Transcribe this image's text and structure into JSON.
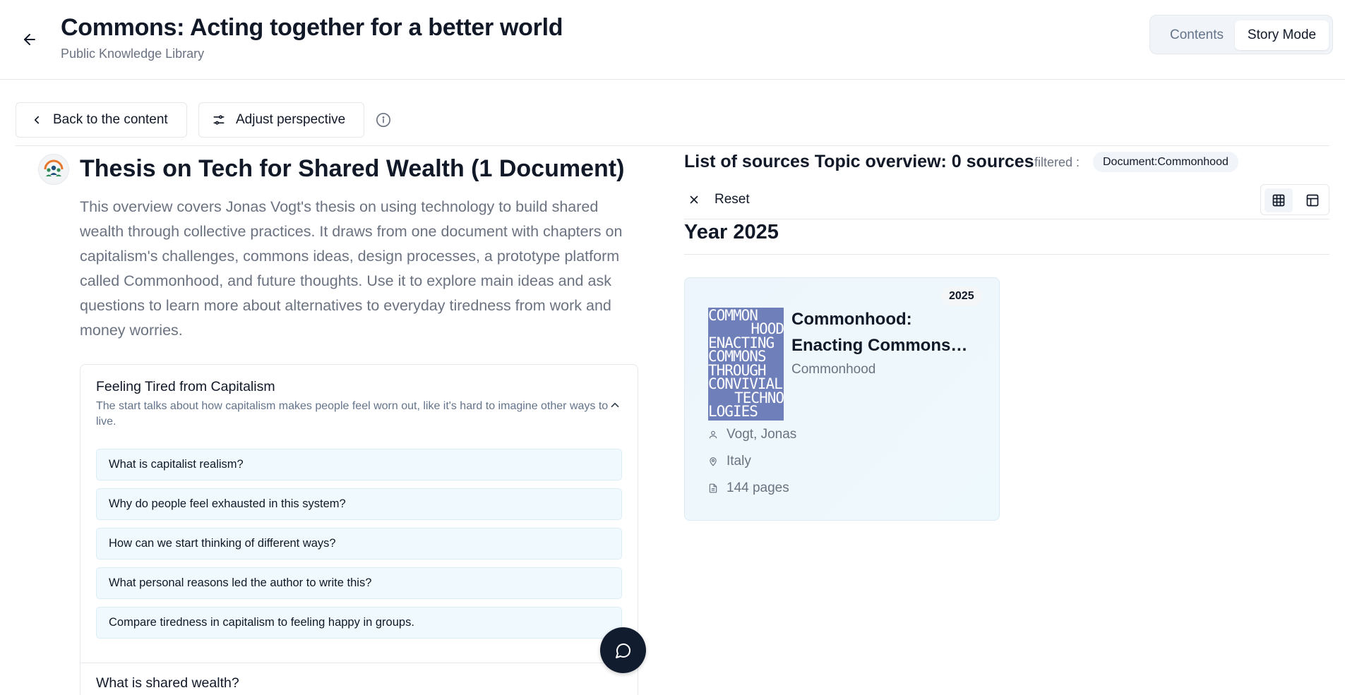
{
  "header": {
    "title": "Commons: Acting together for a better world",
    "subtitle": "Public Knowledge Library",
    "modes": {
      "contents": "Contents",
      "story": "Story Mode",
      "active": "Story Mode"
    }
  },
  "toolbar": {
    "back_label": "Back to the content",
    "adjust_label": "Adjust perspective"
  },
  "topic": {
    "title": "Thesis on Tech for Shared Wealth (1 Document)",
    "description": "This overview covers Jonas Vogt's thesis on using technology to build shared wealth through collective practices. It draws from one document with chapters on capitalism's challenges, commons ideas, design processes, a prototype platform called Commonhood, and future thoughts. Use it to explore main ideas and ask questions to learn more about alternatives to everyday tiredness from work and money worries."
  },
  "accordion": {
    "section1": {
      "title": "Feeling Tired from Capitalism",
      "description": "The start talks about how capitalism makes people feel worn out, like it's hard to imagine other ways to live.",
      "questions": [
        "What is capitalist realism?",
        "Why do people feel exhausted in this system?",
        "How can we start thinking of different ways?",
        "What personal reasons led the author to write this?",
        "Compare tiredness in capitalism to feeling happy in groups."
      ]
    },
    "section2": {
      "title": "What is shared wealth?"
    }
  },
  "sources": {
    "title": "List of sources Topic overview: 0 sources",
    "filtered_label": "filtered :",
    "filter_chip": "Document:Commonhood",
    "reset_label": "Reset",
    "year_heading": "Year 2025",
    "view_mode": "grid",
    "cards": [
      {
        "year": "2025",
        "title": "Commonhood: Enacting Commons…",
        "publisher": "Commonhood",
        "author": "Vogt, Jonas",
        "location": "Italy",
        "pages": "144 pages",
        "cover_text": [
          "COMMON",
          "HOOD",
          "ENACTING",
          "COMMONS",
          "THROUGH",
          "CONVIVIAL",
          "TECHNO",
          "LOGIES"
        ],
        "cover_color": "#6f7fb9"
      }
    ]
  },
  "colors": {
    "accent_bg": "#eff9fe",
    "fab_bg": "#111c2e",
    "text_primary": "#111827",
    "text_muted": "#6b7280"
  },
  "icons": [
    "arrow-left-icon",
    "chevron-left-icon",
    "sliders-icon",
    "info-icon",
    "chevron-up-icon",
    "chat-icon",
    "close-icon",
    "grid-icon",
    "table-icon",
    "user-icon",
    "map-pin-icon",
    "file-icon"
  ]
}
